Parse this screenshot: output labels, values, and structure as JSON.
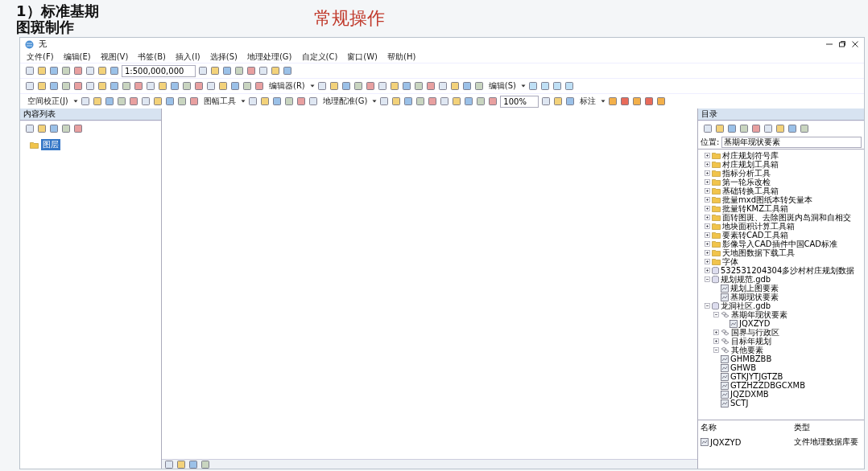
{
  "slide": {
    "title": "1）标准基期图斑制作",
    "subtitle": "常规操作"
  },
  "window": {
    "title": "无"
  },
  "menu": [
    "文件(F)",
    "编辑(E)",
    "视图(V)",
    "书签(B)",
    "插入(I)",
    "选择(S)",
    "地理处理(G)",
    "自定义(C)",
    "窗口(W)",
    "帮助(H)"
  ],
  "toolbar": {
    "scale": "1:500,000,000",
    "editor_menu": "编辑器(R)",
    "spatial_adjust_menu": "空间校正(J)",
    "map_tools_menu": "图幅工具",
    "georef_menu": "地理配准(G)",
    "edit_menu": "编辑(S)",
    "label_menu": "标注",
    "zoom": "100%"
  },
  "toc": {
    "title": "内容列表",
    "items": [
      {
        "label": "图层",
        "selected": true
      }
    ]
  },
  "catalog": {
    "title": "目录",
    "location_label": "位置:",
    "location": "基期年现状要素",
    "tree": [
      {
        "label": "村庄规划符号库",
        "kind": "folder",
        "expanded": false
      },
      {
        "label": "村庄规划工具箱",
        "kind": "folder",
        "expanded": false
      },
      {
        "label": "指标分析工具",
        "kind": "folder",
        "expanded": false
      },
      {
        "label": "第一轮乐改检",
        "kind": "folder",
        "expanded": false
      },
      {
        "label": "基础转换工具箱",
        "kind": "folder",
        "expanded": false
      },
      {
        "label": "批量mxd图纸本转矢量本",
        "kind": "folder",
        "expanded": false
      },
      {
        "label": "批量转KMZ工具箱",
        "kind": "folder",
        "expanded": false
      },
      {
        "label": "面转图斑、去除图斑内岛洞和自相交",
        "kind": "folder",
        "expanded": false
      },
      {
        "label": "地块面积计算工具箱",
        "kind": "folder",
        "expanded": false
      },
      {
        "label": "要素转CAD工具箱",
        "kind": "folder",
        "expanded": false
      },
      {
        "label": "影像导入CAD插件中国CAD标准",
        "kind": "folder",
        "expanded": false
      },
      {
        "label": "天地图数据下载工具",
        "kind": "folder",
        "expanded": false
      },
      {
        "label": "字体",
        "kind": "folder",
        "expanded": false
      },
      {
        "label": "532531204304多沙村村庄规划数据",
        "kind": "gdb",
        "expanded": false
      },
      {
        "label": "规划规范.gdb",
        "kind": "gdb",
        "expanded": true,
        "children": [
          {
            "label": "规划上图要素",
            "kind": "table"
          },
          {
            "label": "基期现状要素",
            "kind": "table"
          }
        ]
      },
      {
        "label": "龙洞社区.gdb",
        "kind": "gdb",
        "expanded": true,
        "children": [
          {
            "label": "基期年现状要素",
            "kind": "dataset",
            "expanded": true,
            "children": [
              {
                "label": "JQXZYD",
                "kind": "table"
              }
            ]
          },
          {
            "label": "国界与行政区",
            "kind": "dataset",
            "expanded": false
          },
          {
            "label": "目标年规划",
            "kind": "dataset",
            "expanded": false
          },
          {
            "label": "其他要素",
            "kind": "dataset",
            "expanded": true
          },
          {
            "label": "GHMBZBB",
            "kind": "table"
          },
          {
            "label": "GHWB",
            "kind": "table"
          },
          {
            "label": "GTKJYTJGTZB",
            "kind": "table"
          },
          {
            "label": "GTZHZZDBGCXMB",
            "kind": "table"
          },
          {
            "label": "JQZDXMB",
            "kind": "table"
          },
          {
            "label": "SCTJ",
            "kind": "table"
          }
        ]
      }
    ],
    "columns": [
      "名称",
      "类型"
    ],
    "rows": [
      {
        "name": "JQXZYD",
        "type": "文件地理数据库要"
      }
    ]
  }
}
